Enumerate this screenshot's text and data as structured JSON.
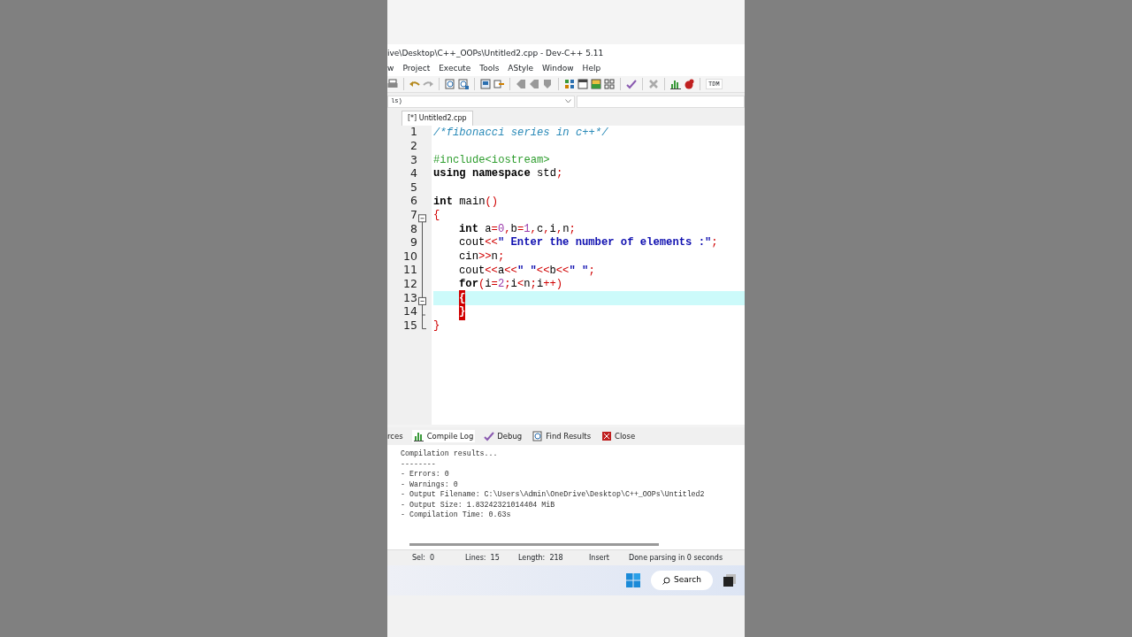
{
  "window": {
    "title": "ive\\Desktop\\C++_OOPs\\Untitled2.cpp - Dev-C++ 5.11"
  },
  "menu": [
    "w",
    "Project",
    "Execute",
    "Tools",
    "AStyle",
    "Window",
    "Help"
  ],
  "toolbar": {
    "compiler_select": "TDM"
  },
  "class_select": {
    "value": "ls)"
  },
  "editor_tabs": [
    {
      "label": "[*] Untitled2.cpp",
      "selected": true
    }
  ],
  "code_lines": [
    {
      "number": "1",
      "tokens": [
        {
          "kind": "comment",
          "text": "/*fibonacci series in c++*/"
        }
      ]
    },
    {
      "number": "2"
    },
    {
      "number": "3",
      "tokens": [
        {
          "kind": "preproc",
          "text": "#include<iostream>"
        }
      ]
    },
    {
      "number": "4",
      "tokens": [
        {
          "kind": "keyword",
          "text": "using namespace"
        },
        {
          "kind": "plain",
          "text": " std"
        },
        {
          "kind": "symbol",
          "text": ";"
        }
      ]
    },
    {
      "number": "5"
    },
    {
      "number": "6",
      "tokens": [
        {
          "kind": "keyword",
          "text": "int"
        },
        {
          "kind": "plain",
          "text": " main"
        },
        {
          "kind": "symbol",
          "text": "()"
        }
      ]
    },
    {
      "number": "7",
      "foldable": true,
      "tokens": [
        {
          "kind": "symbol",
          "text": "{"
        }
      ]
    },
    {
      "number": "8",
      "indented": true,
      "tokens": [
        {
          "kind": "keyword",
          "text": "int"
        },
        {
          "kind": "plain",
          "text": " a"
        },
        {
          "kind": "symbol",
          "text": "="
        },
        {
          "kind": "number",
          "text": "0"
        },
        {
          "kind": "symbol",
          "text": ","
        },
        {
          "kind": "plain",
          "text": "b"
        },
        {
          "kind": "symbol",
          "text": "="
        },
        {
          "kind": "number",
          "text": "1"
        },
        {
          "kind": "symbol",
          "text": ","
        },
        {
          "kind": "plain",
          "text": "c"
        },
        {
          "kind": "symbol",
          "text": ","
        },
        {
          "kind": "plain",
          "text": "i"
        },
        {
          "kind": "symbol",
          "text": ","
        },
        {
          "kind": "plain",
          "text": "n"
        },
        {
          "kind": "symbol",
          "text": ";"
        }
      ]
    },
    {
      "number": "9",
      "indented": true,
      "tokens": [
        {
          "kind": "plain",
          "text": "cout"
        },
        {
          "kind": "symbol",
          "text": "<<"
        },
        {
          "kind": "string",
          "text": "\" Enter the number of elements :\""
        },
        {
          "kind": "symbol",
          "text": ";"
        }
      ]
    },
    {
      "number": "10",
      "indented": true,
      "tokens": [
        {
          "kind": "plain",
          "text": "cin"
        },
        {
          "kind": "symbol",
          "text": ">>"
        },
        {
          "kind": "plain",
          "text": "n"
        },
        {
          "kind": "symbol",
          "text": ";"
        }
      ]
    },
    {
      "number": "11",
      "indented": true,
      "tokens": [
        {
          "kind": "plain",
          "text": "cout"
        },
        {
          "kind": "symbol",
          "text": "<<"
        },
        {
          "kind": "plain",
          "text": "a"
        },
        {
          "kind": "symbol",
          "text": "<<"
        },
        {
          "kind": "string",
          "text": "\" \""
        },
        {
          "kind": "symbol",
          "text": "<<"
        },
        {
          "kind": "plain",
          "text": "b"
        },
        {
          "kind": "symbol",
          "text": "<<"
        },
        {
          "kind": "string",
          "text": "\" \""
        },
        {
          "kind": "symbol",
          "text": ";"
        }
      ]
    },
    {
      "number": "12",
      "indented": true,
      "tokens": [
        {
          "kind": "keyword",
          "text": "for"
        },
        {
          "kind": "symbol",
          "text": "("
        },
        {
          "kind": "plain",
          "text": "i"
        },
        {
          "kind": "symbol",
          "text": "="
        },
        {
          "kind": "number",
          "text": "2"
        },
        {
          "kind": "symbol",
          "text": ";"
        },
        {
          "kind": "plain",
          "text": "i"
        },
        {
          "kind": "symbol",
          "text": "<"
        },
        {
          "kind": "plain",
          "text": "n"
        },
        {
          "kind": "symbol",
          "text": ";"
        },
        {
          "kind": "plain",
          "text": "i"
        },
        {
          "kind": "symbol",
          "text": "++)"
        }
      ]
    },
    {
      "number": "13",
      "foldable": true,
      "current": true,
      "indented": true,
      "tokens": [
        {
          "kind": "brace_match",
          "text": "{"
        }
      ]
    },
    {
      "number": "14",
      "indented": true,
      "tokens": [
        {
          "kind": "brace_match",
          "text": "}"
        }
      ]
    },
    {
      "number": "15",
      "tokens": [
        {
          "kind": "symbol",
          "text": "}"
        }
      ]
    }
  ],
  "bottom_tabs": [
    {
      "label": "rces",
      "selected": false
    },
    {
      "label": "Compile Log",
      "selected": true
    },
    {
      "label": "Debug",
      "selected": false
    },
    {
      "label": "Find Results",
      "selected": false
    },
    {
      "label": "Close",
      "selected": false
    }
  ],
  "compile_log": [
    "Compilation results...",
    "--------",
    "- Errors: 0",
    "- Warnings: 0",
    "- Output Filename: C:\\Users\\Admin\\OneDrive\\Desktop\\C++_OOPs\\Untitled2",
    "- Output Size: 1.83242321014404 MiB",
    "- Compilation Time: 0.63s"
  ],
  "status_bar": [
    {
      "label": "Sel:",
      "value": "0"
    },
    {
      "label": "Lines:",
      "value": "15"
    },
    {
      "label": "Length:",
      "value": "218"
    },
    {
      "value": "Insert"
    },
    {
      "value": "Done parsing in 0 seconds"
    }
  ],
  "taskbar": {
    "search": "Search"
  }
}
